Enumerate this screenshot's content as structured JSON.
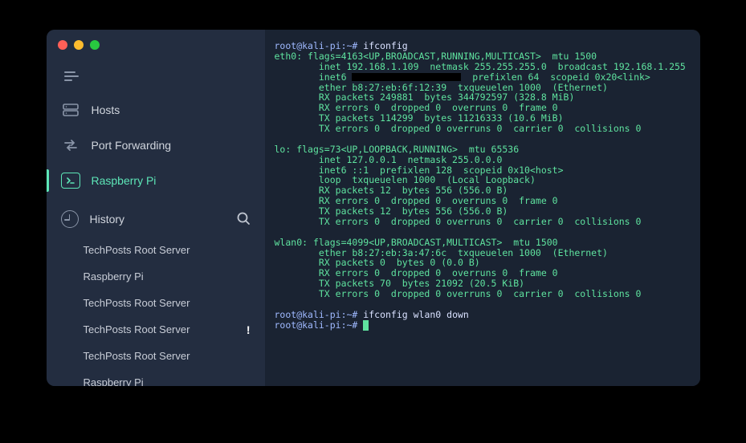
{
  "nav": {
    "hosts": "Hosts",
    "port_forwarding": "Port Forwarding",
    "raspberry_pi": "Raspberry Pi"
  },
  "history": {
    "label": "History",
    "items": [
      {
        "label": "TechPosts Root Server",
        "flag": ""
      },
      {
        "label": "Raspberry Pi",
        "flag": ""
      },
      {
        "label": "TechPosts Root Server",
        "flag": ""
      },
      {
        "label": "TechPosts Root Server",
        "flag": "!"
      },
      {
        "label": "TechPosts Root Server",
        "flag": ""
      },
      {
        "label": "Raspberry Pi",
        "flag": ""
      }
    ]
  },
  "terminal": {
    "prompt1": "root@kali-pi:~#",
    "cmd1": "ifconfig",
    "eth0_l1": "eth0: flags=4163<UP,BROADCAST,RUNNING,MULTICAST>  mtu 1500",
    "eth0_l2a": "        inet 192.168.1.109  netmask 255.255.255.0  broadcast 192.168.1.255",
    "eth0_l3a": "        inet6 ",
    "eth0_l3b": "  prefixlen 64  scopeid 0x20<link>",
    "eth0_l4": "        ether b8:27:eb:6f:12:39  txqueuelen 1000  (Ethernet)",
    "eth0_l5": "        RX packets 249881  bytes 344792597 (328.8 MiB)",
    "eth0_l6": "        RX errors 0  dropped 0  overruns 0  frame 0",
    "eth0_l7": "        TX packets 114299  bytes 11216333 (10.6 MiB)",
    "eth0_l8": "        TX errors 0  dropped 0 overruns 0  carrier 0  collisions 0",
    "lo_l1": "lo: flags=73<UP,LOOPBACK,RUNNING>  mtu 65536",
    "lo_l2": "        inet 127.0.0.1  netmask 255.0.0.0",
    "lo_l3": "        inet6 ::1  prefixlen 128  scopeid 0x10<host>",
    "lo_l4": "        loop  txqueuelen 1000  (Local Loopback)",
    "lo_l5": "        RX packets 12  bytes 556 (556.0 B)",
    "lo_l6": "        RX errors 0  dropped 0  overruns 0  frame 0",
    "lo_l7": "        TX packets 12  bytes 556 (556.0 B)",
    "lo_l8": "        TX errors 0  dropped 0 overruns 0  carrier 0  collisions 0",
    "wlan_l1": "wlan0: flags=4099<UP,BROADCAST,MULTICAST>  mtu 1500",
    "wlan_l2": "        ether b8:27:eb:3a:47:6c  txqueuelen 1000  (Ethernet)",
    "wlan_l3": "        RX packets 0  bytes 0 (0.0 B)",
    "wlan_l4": "        RX errors 0  dropped 0  overruns 0  frame 0",
    "wlan_l5": "        TX packets 70  bytes 21092 (20.5 KiB)",
    "wlan_l6": "        TX errors 0  dropped 0 overruns 0  carrier 0  collisions 0",
    "prompt2": "root@kali-pi:~#",
    "cmd2": "ifconfig wlan0 down",
    "prompt3": "root@kali-pi:~#"
  }
}
